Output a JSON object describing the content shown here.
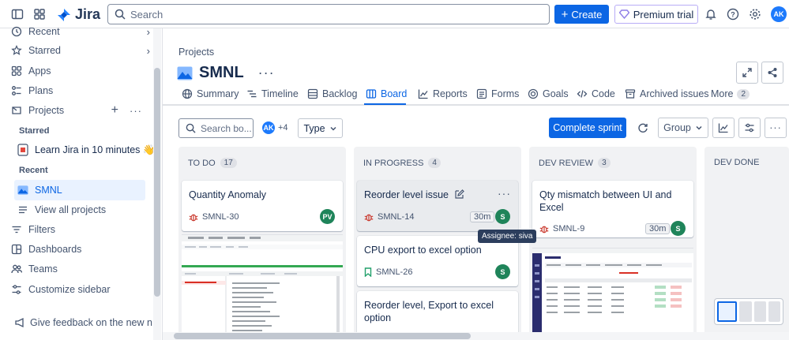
{
  "topbar": {
    "app_name": "Jira",
    "search_placeholder": "Search",
    "create_label": "Create",
    "premium_label": "Premium trial",
    "user_initials": "AK"
  },
  "sidebar": {
    "items": [
      {
        "label": "Recent",
        "icon": "clock-icon"
      },
      {
        "label": "Starred",
        "icon": "star-icon"
      },
      {
        "label": "Apps",
        "icon": "apps-icon"
      },
      {
        "label": "Plans",
        "icon": "plans-icon"
      },
      {
        "label": "Projects",
        "icon": "projects-icon"
      }
    ],
    "starred_header": "Starred",
    "starred_item": "Learn Jira in 10 minutes 👋",
    "recent_header": "Recent",
    "recent_item": "SMNL",
    "view_all": "View all projects",
    "bottom_items": [
      {
        "label": "Filters",
        "icon": "filter-icon"
      },
      {
        "label": "Dashboards",
        "icon": "dashboard-icon"
      },
      {
        "label": "Teams",
        "icon": "teams-icon"
      },
      {
        "label": "Customize sidebar",
        "icon": "customize-icon"
      }
    ],
    "feedback": "Give feedback on the new n..."
  },
  "project": {
    "breadcrumb": "Projects",
    "name": "SMNL"
  },
  "tabs": [
    {
      "label": "Summary",
      "icon": "globe-icon"
    },
    {
      "label": "Timeline",
      "icon": "timeline-icon"
    },
    {
      "label": "Backlog",
      "icon": "backlog-icon"
    },
    {
      "label": "Board",
      "icon": "board-icon",
      "active": true
    },
    {
      "label": "Reports",
      "icon": "reports-icon"
    },
    {
      "label": "Forms",
      "icon": "forms-icon"
    },
    {
      "label": "Goals",
      "icon": "goals-icon"
    },
    {
      "label": "Code",
      "icon": "code-icon"
    },
    {
      "label": "Archived issues",
      "icon": "archive-icon"
    },
    {
      "label": "More",
      "icon": "",
      "count": "2"
    }
  ],
  "board_toolbar": {
    "search_placeholder": "Search bo...",
    "avatar_initials": "AK",
    "extra_count": "+4",
    "type_label": "Type",
    "complete_label": "Complete sprint",
    "group_label": "Group"
  },
  "columns": [
    {
      "title": "TO DO",
      "count": "17",
      "cards": [
        {
          "title": "Quantity Anomaly",
          "key": "SMNL-30",
          "type": "bug",
          "assignee": "PV",
          "assignee_color": "#1f845a"
        }
      ]
    },
    {
      "title": "IN PROGRESS",
      "count": "4",
      "cards": [
        {
          "title": "Reorder level issue",
          "key": "SMNL-14",
          "type": "bug",
          "estimate": "30m",
          "assignee": "S",
          "assignee_color": "#1f845a"
        },
        {
          "title": "CPU export to excel option",
          "key": "SMNL-26",
          "type": "story",
          "assignee": "S",
          "assignee_color": "#1f845a"
        },
        {
          "title": "Reorder level, Export to excel option",
          "key": "",
          "type": ""
        }
      ]
    },
    {
      "title": "DEV REVIEW",
      "count": "3",
      "cards": [
        {
          "title": "Qty mismatch between UI and Excel",
          "key": "SMNL-9",
          "type": "bug",
          "estimate": "30m",
          "assignee": "S",
          "assignee_color": "#1f845a"
        }
      ]
    },
    {
      "title": "DEV DONE",
      "count": "",
      "cards": []
    }
  ],
  "tooltip": "Assignee: siva",
  "colors": {
    "accent": "#0c66e4",
    "bug": "#c9372c",
    "story": "#22a06b",
    "avatar_ak": "#1d7afc"
  }
}
